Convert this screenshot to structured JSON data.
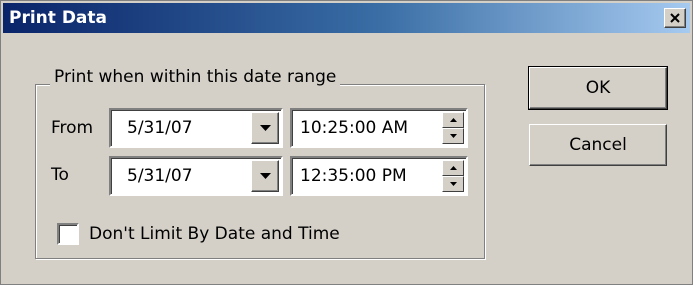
{
  "window": {
    "title": "Print Data"
  },
  "group": {
    "label": "Print when within this date range"
  },
  "from": {
    "label": "From",
    "date": "5/31/07",
    "time": "10:25:00 AM"
  },
  "to": {
    "label": "To",
    "date": "5/31/07",
    "time": "12:35:00 PM"
  },
  "checkbox": {
    "label": "Don't Limit By Date and Time",
    "checked": false
  },
  "buttons": {
    "ok": "OK",
    "cancel": "Cancel"
  },
  "colors": {
    "titlebar_start": "#0a246a",
    "titlebar_end": "#a6caf0",
    "face": "#d4d0c8"
  }
}
